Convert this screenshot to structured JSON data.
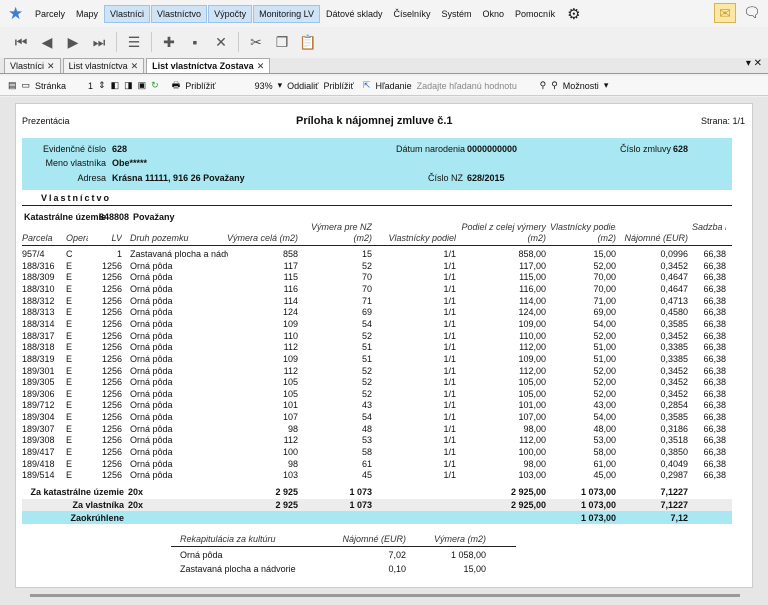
{
  "menu": [
    "Parcely",
    "Mapy",
    "Vlastníci",
    "Vlastníctvo",
    "Výpočty",
    "Monitoring LV",
    "Dátové sklady",
    "Číselníky",
    "Systém",
    "Okno",
    "Pomocník"
  ],
  "tabs": [
    "Vlastníci",
    "List vlastníctva",
    "List vlastníctva Zostava"
  ],
  "report_toolbar": {
    "page_label": "Stránka",
    "page_value": "1",
    "zoom_in": "Priblížiť",
    "zoom_value": "93%",
    "zoom_out": "Oddialiť",
    "zoom": "Priblížiť",
    "search_label": "Hľadanie",
    "search_placeholder": "Zadajte hľadanú hodnotu",
    "options": "Možnosti"
  },
  "report": {
    "left_title": "Prezentácia",
    "title": "Príloha k nájomnej zmluve č.1",
    "page": "Strana: 1/1",
    "ev_label": "Evidenčné číslo",
    "ev_value": "628",
    "dob_label": "Dátum narodenia",
    "dob_value": "0000000000",
    "contract_label": "Číslo zmluvy",
    "contract_value": "628",
    "owner_label": "Meno vlastníka",
    "owner_value": "Obe*****",
    "address_label": "Adresa",
    "address_value": "Krásna 11111, 916 26 Považany",
    "nz_label": "Číslo NZ",
    "nz_value": "628/2015",
    "section": "Vlastníctvo",
    "ku_label": "Katastrálne územie",
    "ku_code": "848808",
    "ku_name": "Považany",
    "columns": [
      "Parcela",
      "Operát",
      "LV",
      "Druh pozemku",
      "Výmera celá (m2)",
      "Výmera pre NZ (m2)",
      "Vlastnícky podiel",
      "Podiel z celej výmery (m2)",
      "Vlastnícky podiel (m2)",
      "Nájomné (EUR)",
      "Sadzba EUR/ha"
    ],
    "rows": [
      [
        "957/4",
        "C",
        "1",
        "Zastavaná plocha a nádvo",
        "858",
        "15",
        "1/1",
        "858,00",
        "15,00",
        "0,0996",
        "66,38"
      ],
      [
        "188/316",
        "E",
        "1256",
        "Orná pôda",
        "117",
        "52",
        "1/1",
        "117,00",
        "52,00",
        "0,3452",
        "66,38"
      ],
      [
        "188/309",
        "E",
        "1256",
        "Orná pôda",
        "115",
        "70",
        "1/1",
        "115,00",
        "70,00",
        "0,4647",
        "66,38"
      ],
      [
        "188/310",
        "E",
        "1256",
        "Orná pôda",
        "116",
        "70",
        "1/1",
        "116,00",
        "70,00",
        "0,4647",
        "66,38"
      ],
      [
        "188/312",
        "E",
        "1256",
        "Orná pôda",
        "114",
        "71",
        "1/1",
        "114,00",
        "71,00",
        "0,4713",
        "66,38"
      ],
      [
        "188/313",
        "E",
        "1256",
        "Orná pôda",
        "124",
        "69",
        "1/1",
        "124,00",
        "69,00",
        "0,4580",
        "66,38"
      ],
      [
        "188/314",
        "E",
        "1256",
        "Orná pôda",
        "109",
        "54",
        "1/1",
        "109,00",
        "54,00",
        "0,3585",
        "66,38"
      ],
      [
        "188/317",
        "E",
        "1256",
        "Orná pôda",
        "110",
        "52",
        "1/1",
        "110,00",
        "52,00",
        "0,3452",
        "66,38"
      ],
      [
        "188/318",
        "E",
        "1256",
        "Orná pôda",
        "112",
        "51",
        "1/1",
        "112,00",
        "51,00",
        "0,3385",
        "66,38"
      ],
      [
        "188/319",
        "E",
        "1256",
        "Orná pôda",
        "109",
        "51",
        "1/1",
        "109,00",
        "51,00",
        "0,3385",
        "66,38"
      ],
      [
        "189/301",
        "E",
        "1256",
        "Orná pôda",
        "112",
        "52",
        "1/1",
        "112,00",
        "52,00",
        "0,3452",
        "66,38"
      ],
      [
        "189/305",
        "E",
        "1256",
        "Orná pôda",
        "105",
        "52",
        "1/1",
        "105,00",
        "52,00",
        "0,3452",
        "66,38"
      ],
      [
        "189/306",
        "E",
        "1256",
        "Orná pôda",
        "105",
        "52",
        "1/1",
        "105,00",
        "52,00",
        "0,3452",
        "66,38"
      ],
      [
        "189/712",
        "E",
        "1256",
        "Orná pôda",
        "101",
        "43",
        "1/1",
        "101,00",
        "43,00",
        "0,2854",
        "66,38"
      ],
      [
        "189/304",
        "E",
        "1256",
        "Orná pôda",
        "107",
        "54",
        "1/1",
        "107,00",
        "54,00",
        "0,3585",
        "66,38"
      ],
      [
        "189/307",
        "E",
        "1256",
        "Orná pôda",
        "98",
        "48",
        "1/1",
        "98,00",
        "48,00",
        "0,3186",
        "66,38"
      ],
      [
        "189/308",
        "E",
        "1256",
        "Orná pôda",
        "112",
        "53",
        "1/1",
        "112,00",
        "53,00",
        "0,3518",
        "66,38"
      ],
      [
        "189/417",
        "E",
        "1256",
        "Orná pôda",
        "100",
        "58",
        "1/1",
        "100,00",
        "58,00",
        "0,3850",
        "66,38"
      ],
      [
        "189/418",
        "E",
        "1256",
        "Orná pôda",
        "98",
        "61",
        "1/1",
        "98,00",
        "61,00",
        "0,4049",
        "66,38"
      ],
      [
        "189/514",
        "E",
        "1256",
        "Orná pôda",
        "103",
        "45",
        "1/1",
        "103,00",
        "45,00",
        "0,2987",
        "66,38"
      ]
    ],
    "sum_ku": [
      "Za katastrálne územie",
      "20x",
      "2 925",
      "1 073",
      "2 925,00",
      "1 073,00",
      "7,1227"
    ],
    "sum_owner": [
      "Za vlastníka",
      "20x",
      "2 925",
      "1 073",
      "2 925,00",
      "1 073,00",
      "7,1227"
    ],
    "rounded": [
      "Zaokrúhlene",
      "1 073,00",
      "7,12"
    ],
    "recap_headers": [
      "Rekapitulácia za kultúru",
      "Nájomné (EUR)",
      "Výmera (m2)"
    ],
    "recap_rows": [
      [
        "Orná pôda",
        "7,02",
        "1 058,00"
      ],
      [
        "Zastavaná plocha a nádvorie",
        "0,10",
        "15,00"
      ]
    ]
  }
}
